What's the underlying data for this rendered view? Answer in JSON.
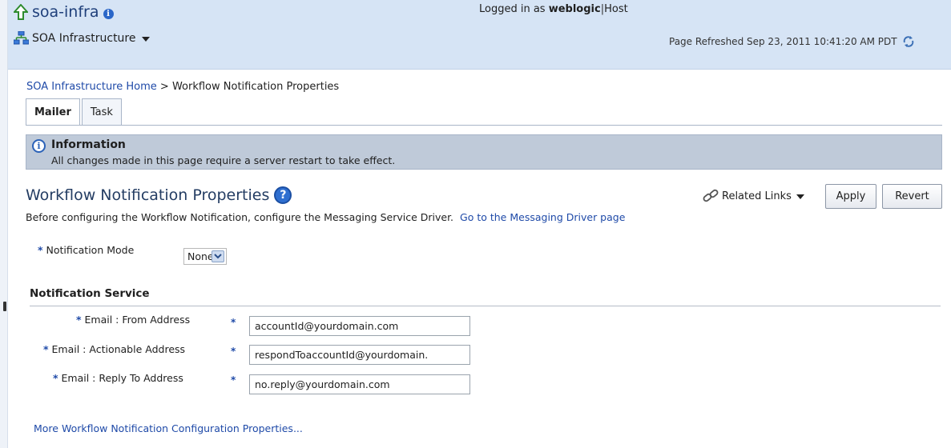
{
  "header": {
    "target_name": "soa-infra",
    "menu_label": "SOA Infrastructure",
    "logged_in_prefix": "Logged in as",
    "user": "weblogic",
    "separator": "|",
    "host": "Host",
    "refreshed": "Page Refreshed Sep 23, 2011 10:41:20 AM PDT"
  },
  "breadcrumb": {
    "home": "SOA Infrastructure Home",
    "separator": ">",
    "current": "Workflow Notification Properties"
  },
  "tabs": [
    {
      "label": "Mailer",
      "active": true
    },
    {
      "label": "Task",
      "active": false
    }
  ],
  "banner": {
    "title": "Information",
    "message": "All changes made in this page require a server restart to take effect."
  },
  "page": {
    "title": "Workflow Notification Properties",
    "instructions": "Before configuring the Workflow Notification, configure the Messaging Service Driver.",
    "messaging_link": "Go to the Messaging Driver page",
    "related_links": "Related Links",
    "apply": "Apply",
    "revert": "Revert"
  },
  "mode": {
    "required_marker": "*",
    "label": "Notification Mode",
    "selected": "None"
  },
  "section": {
    "title": "Notification Service",
    "fields": [
      {
        "label": "Email : From Address",
        "marker": "*",
        "value": "accountId@yourdomain.com"
      },
      {
        "label": "Email : Actionable Address",
        "marker": "*",
        "value": "respondToaccountId@yourdomain."
      },
      {
        "label": "Email : Reply To Address",
        "marker": "*",
        "value": "no.reply@yourdomain.com"
      }
    ]
  },
  "more_link": "More Workflow Notification Configuration Properties...",
  "colors": {
    "header_bg": "#d6e4f5",
    "banner_bg": "#bfcad9",
    "link": "#1f4aa8",
    "title": "#243d63"
  }
}
